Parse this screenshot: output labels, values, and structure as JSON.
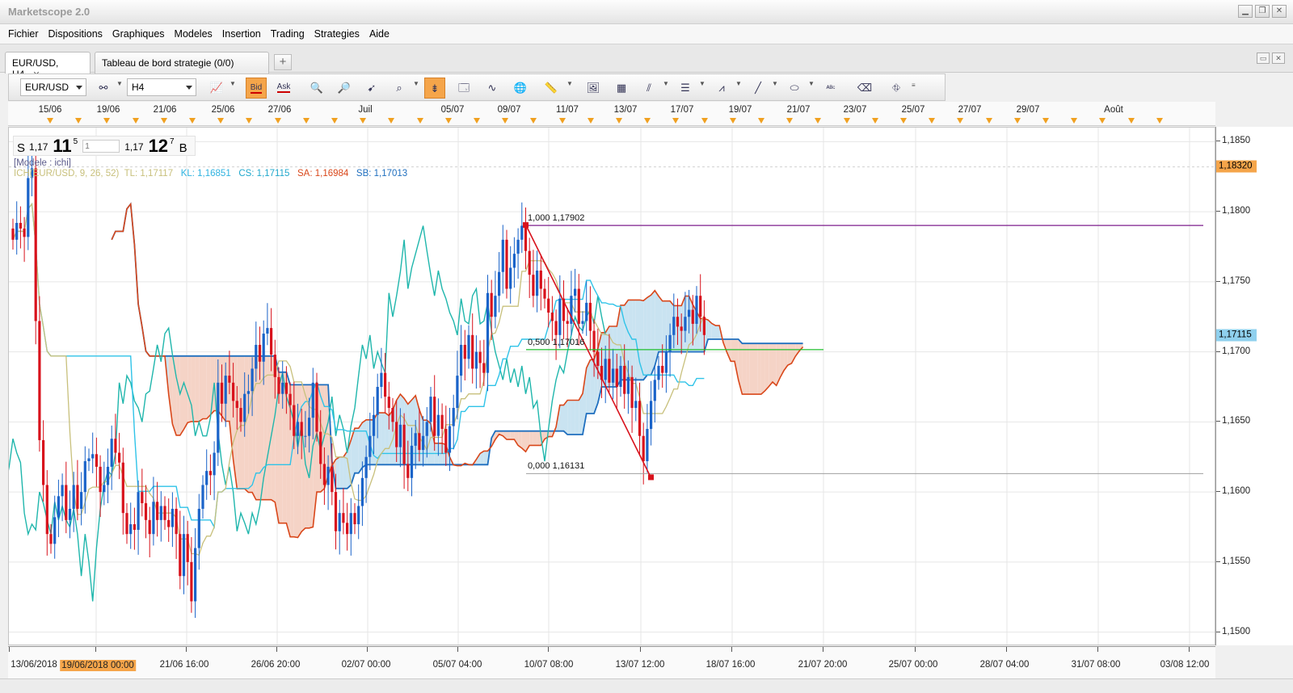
{
  "window": {
    "title": "Marketscope 2.0"
  },
  "menu": [
    "Fichier",
    "Dispositions",
    "Graphiques",
    "Modeles",
    "Insertion",
    "Trading",
    "Strategies",
    "Aide"
  ],
  "tabs": [
    {
      "label": "EUR/USD, H4",
      "active": true
    },
    {
      "label": "Tableau de bord strategie (0/0)",
      "active": false
    }
  ],
  "toolbar": {
    "symbol": "EUR/USD",
    "timeframe": "H4",
    "bid_label": "Bid",
    "ask_label": "Ask"
  },
  "quote": {
    "sell_label": "S",
    "sell_prefix": "1,17",
    "sell_pips": "11",
    "sell_frac": "5",
    "amount_placeholder": "1",
    "buy_prefix": "1,17",
    "buy_pips": "12",
    "buy_frac": "7",
    "buy_label": "B"
  },
  "indicator": {
    "model_label": "[Modele : ichi]",
    "name": "ICH(EUR/USD, 9, 26, 52)",
    "tl": "TL: 1,17117",
    "kl": "KL: 1,16851",
    "cs": "CS: 1,17115",
    "sa": "SA: 1,16984",
    "sb": "SB: 1,17013"
  },
  "colors": {
    "bull": "#1a63c9",
    "bear": "#d8121c",
    "tenkan": "#c8c07c",
    "kijun": "#2fc3e8",
    "chikou": "#1fb6ac",
    "span_a": "#d9471a",
    "span_b": "#1f6fbf",
    "cloud_bull": "#c9e3f1",
    "cloud_bear": "#f5d3c6",
    "fib": "#d8121c",
    "fib_high": "#7d1d8c",
    "fib_mid": "#1fbf2c",
    "highlight": "#f5a54a"
  },
  "fibonacci": {
    "high_label": "1,000 1,17902",
    "mid_label": "0,500 1,17016",
    "low_label": "0,000 1,16131",
    "high_price": 1.17902,
    "mid_price": 1.17016,
    "low_price": 1.16131
  },
  "price_axis": {
    "labels": [
      "1,1850",
      "1,1800",
      "1,1750",
      "1,1700",
      "1,1650",
      "1,1600",
      "1,1550",
      "1,1500"
    ],
    "badge_top": "1,18320",
    "badge_current": "1,17115"
  },
  "time_ruler": {
    "labels": [
      "15/06",
      "19/06",
      "21/06",
      "25/06",
      "27/06",
      "Juil",
      "05/07",
      "09/07",
      "11/07",
      "13/07",
      "17/07",
      "19/07",
      "21/07",
      "23/07",
      "25/07",
      "27/07",
      "29/07",
      "Août"
    ]
  },
  "date_axis": {
    "labels": [
      "13/06/2018",
      "19/06/2018 00:00",
      "21/06 16:00",
      "26/06 20:00",
      "02/07 00:00",
      "05/07 04:00",
      "10/07 08:00",
      "13/07 12:00",
      "18/07 16:00",
      "21/07 20:00",
      "25/07 00:00",
      "28/07 04:00",
      "31/07 08:00",
      "03/08 12:00"
    ],
    "highlighted_index": 1
  },
  "chart_data": {
    "type": "candlestick",
    "symbol": "EUR/USD",
    "timeframe": "H4",
    "ylim": [
      1.149,
      1.186
    ],
    "y_ticks": [
      1.185,
      1.18,
      1.175,
      1.17,
      1.165,
      1.16,
      1.155,
      1.15
    ],
    "current_price": 1.17115,
    "extreme_price": 1.1832,
    "series": {
      "close": [
        1.178,
        1.1792,
        1.1788,
        1.1782,
        1.1824,
        1.1831,
        1.1722,
        1.1637,
        1.1605,
        1.157,
        1.1563,
        1.1582,
        1.1597,
        1.1605,
        1.158,
        1.1588,
        1.1605,
        1.1588,
        1.16,
        1.1622,
        1.1624,
        1.1627,
        1.1618,
        1.16,
        1.1605,
        1.1618,
        1.1638,
        1.1628,
        1.1621,
        1.1585,
        1.157,
        1.1577,
        1.1573,
        1.16,
        1.1592,
        1.158,
        1.157,
        1.1593,
        1.158,
        1.159,
        1.158,
        1.1575,
        1.1588,
        1.157,
        1.154,
        1.157,
        1.155,
        1.1522,
        1.156,
        1.1588,
        1.1605,
        1.1615,
        1.1612,
        1.1628,
        1.1678,
        1.1663,
        1.1683,
        1.1678,
        1.1665,
        1.166,
        1.165,
        1.167,
        1.1672,
        1.1688,
        1.1705,
        1.1693,
        1.1713,
        1.1717,
        1.1698,
        1.1682,
        1.167,
        1.1678,
        1.167,
        1.1662,
        1.164,
        1.165,
        1.164,
        1.164,
        1.1653,
        1.1678,
        1.1643,
        1.162,
        1.1605,
        1.1618,
        1.16,
        1.1572,
        1.1585,
        1.1578,
        1.157,
        1.1585,
        1.1577,
        1.159,
        1.161,
        1.1625,
        1.164,
        1.1655,
        1.1675,
        1.1685,
        1.1668,
        1.166,
        1.165,
        1.1632,
        1.1648,
        1.162,
        1.161,
        1.1633,
        1.1642,
        1.163,
        1.164,
        1.165,
        1.1668,
        1.164,
        1.1655,
        1.1645,
        1.1628,
        1.1647,
        1.166,
        1.1683,
        1.1705,
        1.1695,
        1.1712,
        1.1688,
        1.17,
        1.1692,
        1.1685,
        1.1742,
        1.1725,
        1.174,
        1.1757,
        1.178,
        1.1745,
        1.176,
        1.177,
        1.178,
        1.179,
        1.1772,
        1.1755,
        1.174,
        1.1758,
        1.1745,
        1.1738,
        1.1728,
        1.1722,
        1.1712,
        1.1738,
        1.1722,
        1.172,
        1.174,
        1.1745,
        1.172,
        1.1722,
        1.1735,
        1.1715,
        1.17,
        1.169,
        1.168,
        1.1695,
        1.1678,
        1.1688,
        1.1675,
        1.169,
        1.167,
        1.1682,
        1.166,
        1.1665,
        1.164,
        1.1622,
        1.1645,
        1.1665,
        1.168,
        1.169,
        1.1685,
        1.17,
        1.1712,
        1.1725,
        1.1718,
        1.1715,
        1.1725,
        1.173,
        1.172,
        1.174,
        1.1725,
        1.1712
      ]
    },
    "indicator": "Ichimoku (9, 26, 52)",
    "fibonacci_levels": [
      {
        "level": 1.0,
        "price": 1.17902
      },
      {
        "level": 0.5,
        "price": 1.17016
      },
      {
        "level": 0.0,
        "price": 1.16131
      }
    ]
  }
}
